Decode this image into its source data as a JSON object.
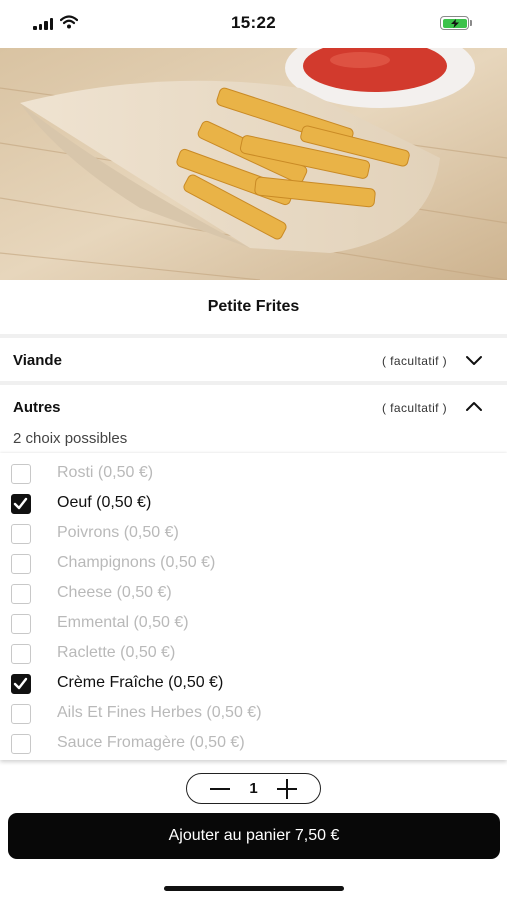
{
  "status_bar": {
    "time": "15:22"
  },
  "product": {
    "image_icon": "french-fries-photo",
    "title": "Petite Frites"
  },
  "sections": [
    {
      "label": "Viande",
      "tag": "( facultatif )",
      "expanded": false
    },
    {
      "label": "Autres",
      "tag": "( facultatif )",
      "expanded": true
    }
  ],
  "choices_hint": "2 choix possibles",
  "options": [
    {
      "label": "Rosti (0,50 €)",
      "checked": false
    },
    {
      "label": "Oeuf (0,50 €)",
      "checked": true
    },
    {
      "label": "Poivrons (0,50 €)",
      "checked": false
    },
    {
      "label": "Champignons (0,50 €)",
      "checked": false
    },
    {
      "label": "Cheese (0,50 €)",
      "checked": false
    },
    {
      "label": "Emmental (0,50 €)",
      "checked": false
    },
    {
      "label": "Raclette (0,50 €)",
      "checked": false
    },
    {
      "label": "Crème Fraîche (0,50 €)",
      "checked": true
    },
    {
      "label": "Ails Et Fines Herbes (0,50 €)",
      "checked": false
    },
    {
      "label": "Sauce Fromagère (0,50 €)",
      "checked": false
    }
  ],
  "quantity": {
    "value": "1"
  },
  "cart": {
    "label": "Ajouter au panier 7,50 €"
  },
  "colors": {
    "accent": "#080808",
    "battery": "#3bc24a",
    "disabled_text": "#b9b9b9"
  }
}
